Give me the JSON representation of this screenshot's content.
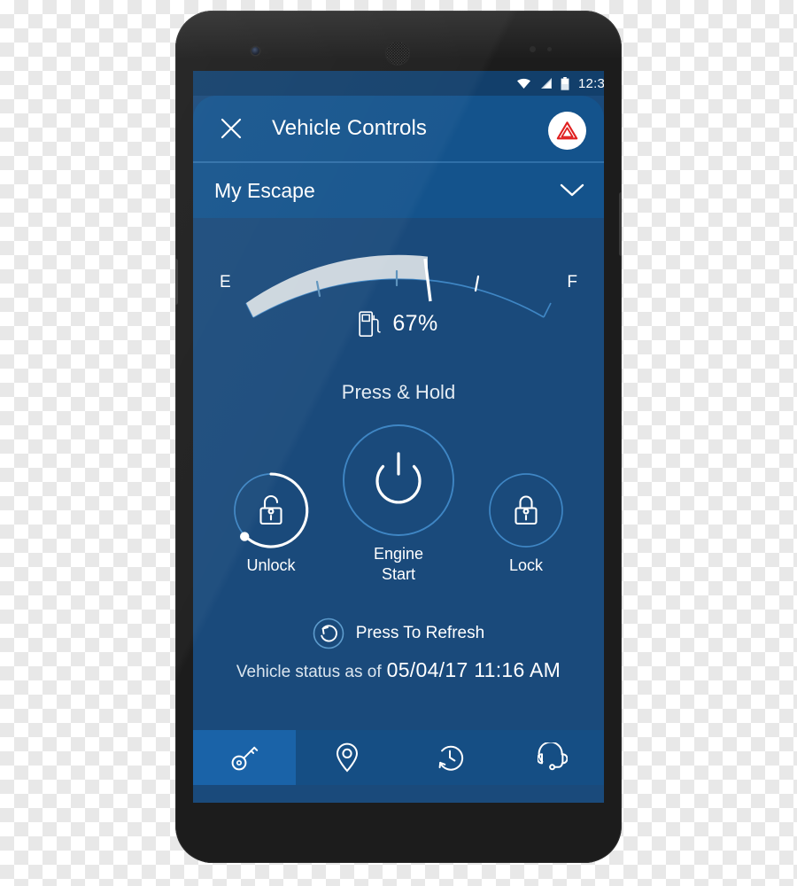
{
  "device": {
    "name": "android-smartphone",
    "camera": "front-camera",
    "speaker": "earpiece-speaker"
  },
  "statusbar": {
    "time": "12:3",
    "icons": [
      "wifi-icon",
      "cellular-signal-icon",
      "battery-icon"
    ]
  },
  "appbar": {
    "close_icon": "close-icon",
    "title": "Vehicle Controls",
    "hazard_icon": "hazard-warning-triangle-icon"
  },
  "vehicle_selector": {
    "name": "My Escape",
    "chevron_icon": "chevron-down-icon"
  },
  "fuel_gauge": {
    "empty_label": "E",
    "full_label": "F",
    "percent_text": "67%",
    "percent_value": 67,
    "pump_icon": "fuel-pump-icon",
    "fill_color": "#ccd6de",
    "track_color": "#3f86c4"
  },
  "controls": {
    "instruction": "Press & Hold",
    "unlock": {
      "label": "Unlock",
      "icon": "unlock-padlock-icon",
      "progress": 66
    },
    "engine": {
      "label": "Engine\nStart",
      "icon": "power-icon"
    },
    "lock": {
      "label": "Lock",
      "icon": "locked-padlock-icon"
    }
  },
  "refresh": {
    "icon": "refresh-counterclockwise-icon",
    "label": "Press To Refresh"
  },
  "status": {
    "prefix": "Vehicle status as of",
    "value": "05/04/17 11:16 AM"
  },
  "bottom_nav": {
    "items": [
      {
        "name": "tab-vehicle-controls",
        "icon": "key-icon",
        "active": true
      },
      {
        "name": "tab-location",
        "icon": "location-pin-icon",
        "active": false
      },
      {
        "name": "tab-history",
        "icon": "clock-history-icon",
        "active": false
      },
      {
        "name": "tab-support",
        "icon": "headset-support-icon",
        "active": false
      }
    ]
  },
  "colors": {
    "screen_bg": "#1a4a7b",
    "appbar_bg": "#14538c",
    "statusbar_bg": "#123f6b",
    "nav_bg": "#154e84",
    "nav_active_bg": "#1a63a8",
    "accent_line": "#3f86c4",
    "hazard_red": "#e02020"
  }
}
